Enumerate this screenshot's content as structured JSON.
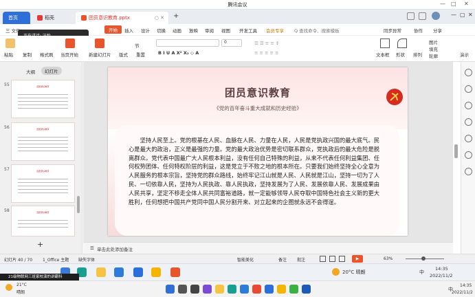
{
  "meeting": {
    "title": "腾讯会议"
  },
  "tabs": [
    {
      "label": "首页"
    },
    {
      "label": "稻壳"
    },
    {
      "label": "团员意识教育.pptx"
    }
  ],
  "menu": {
    "file": "三 文件",
    "items": [
      "开始",
      "插入",
      "设计",
      "切换",
      "动画",
      "放映",
      "审阅",
      "视图",
      "开发工具",
      "会员专享"
    ],
    "search": "Q 查找命令、搜索模板",
    "right": [
      "同步异常",
      "协作",
      "分享"
    ]
  },
  "popup": {
    "text": "正在讲话: 汪怡"
  },
  "ribbon": {
    "labels": [
      "粘贴",
      "复制",
      "格式刷",
      "当页开始",
      "新建幻灯片",
      "版式",
      "节",
      "重置",
      "文本框",
      "形状",
      "排列",
      "图片",
      "填充",
      "轮廓",
      "演示"
    ],
    "font_value": "0"
  },
  "left_panel": {
    "tabs": [
      "大纲",
      "幻灯片"
    ],
    "thumbs": [
      {
        "num": "55",
        "title": "团员意识教育"
      },
      {
        "num": "56",
        "title": "团员意识教育"
      },
      {
        "num": "57",
        "title": "团员意识教育"
      },
      {
        "num": "58",
        "title": "团员意识教育"
      }
    ],
    "add": "+"
  },
  "slide": {
    "title": "团员意识教育",
    "subtitle": "《党的百年奋斗重大成就和历史经验》",
    "body": "坚持人民至上。党的根基在人民、血脉在人民、力量在人民，人民是党执政兴国的最大底气。民心是最大的政治，正义是最强的力量。党的最大政治优势是密切联系群众，党执政后的最大危险是脱离群众。党代表中国最广大人民根本利益，没有任何自己特殊的利益，从来不代表任何利益集团、任何权势团体、任何特权阶层的利益，这是党立于不败之地的根本所在。只要我们始终坚持全心全意为人民服务的根本宗旨，坚持党的群众路线，始终牢记江山就是人民、人民就是江山，坚持一切为了人民、一切依靠人民，坚持为人民执政、靠人民执政，坚持发展为了人民、发展依靠人民、发展成果由人民共享，坚定不移走全体人民共同富裕道路，就一定能够领导人民夺取中国特色社会主义新的更大胜利，任何想把中国共产党同中国人民分割开来、对立起来的企图就永远不会得逞。"
  },
  "notes": {
    "text": "单击此处添加备注"
  },
  "status": {
    "slide_info": "幻灯片 40 / 70",
    "theme": "1_Office 主题",
    "font_missing": "缺失字体",
    "smart": "智能美化",
    "notes": "备注",
    "comments": "批注",
    "zoom": "63%"
  },
  "taskbar": {
    "weather": "20°C 晴朗",
    "lang": "中",
    "time": "14:35",
    "date": "2022/11/2"
  },
  "toast": {
    "text": "21级物联网三班家校演的讲霸科"
  },
  "wtaskbar": {
    "temp": "21°C",
    "cond": "晴朗",
    "lang": "中",
    "time": "14:35",
    "date": "2022/11/2"
  }
}
